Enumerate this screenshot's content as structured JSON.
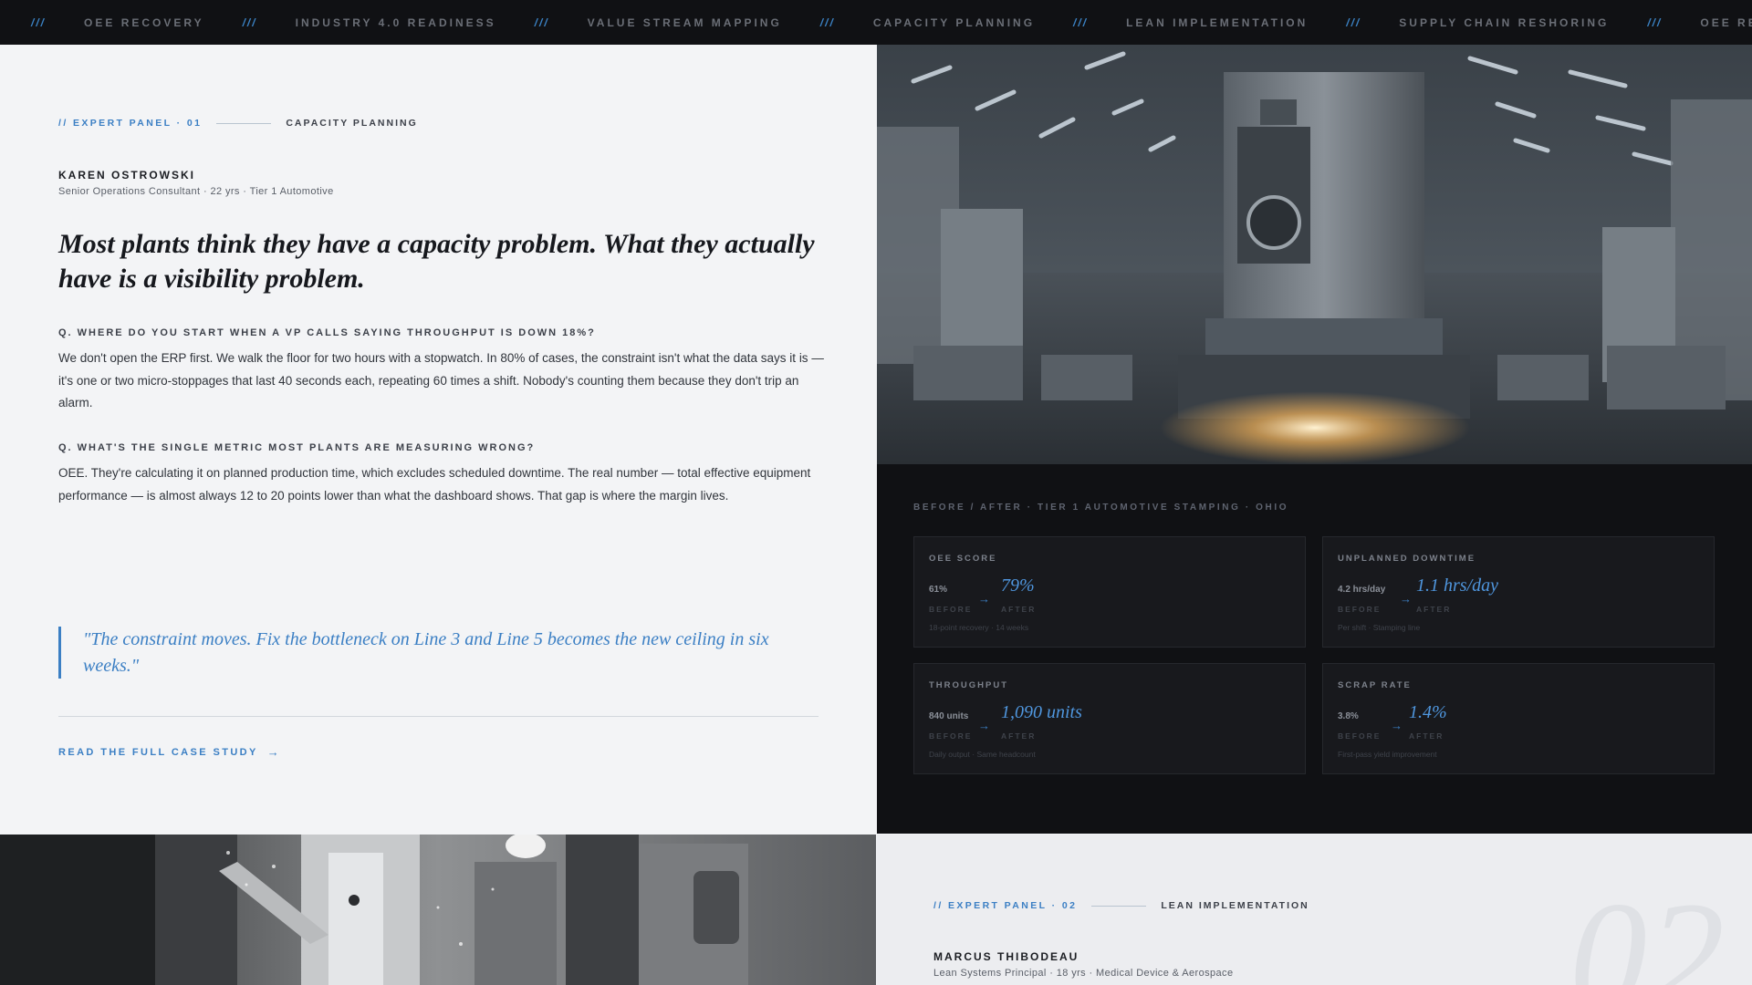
{
  "ticker": {
    "separator": "///",
    "items": [
      "OEE RECOVERY",
      "INDUSTRY 4.0 READINESS",
      "VALUE STREAM MAPPING",
      "CAPACITY PLANNING",
      "LEAN IMPLEMENTATION",
      "SUPPLY CHAIN RESHORING",
      "OEE RECOVERY"
    ]
  },
  "panel1": {
    "code": "// EXPERT PANEL · 01",
    "topic": "CAPACITY PLANNING",
    "name": "KAREN OSTROWSKI",
    "role": "Senior Operations Consultant · 22 yrs · Tier 1 Automotive",
    "headline": "Most plants think they have a capacity problem. What they actually have is a visibility problem.",
    "q1": "Q. WHERE DO YOU START WHEN A VP CALLS SAYING THROUGHPUT IS DOWN 18%?",
    "a1": "We don't open the ERP first. We walk the floor for two hours with a stopwatch. In 80% of cases, the constraint isn't what the data says it is — it's one or two micro-stoppages that last 40 seconds each, repeating 60 times a shift. Nobody's counting them because they don't trip an alarm.",
    "q2": "Q. WHAT'S THE SINGLE METRIC MOST PLANTS ARE MEASURING WRONG?",
    "a2": "OEE. They're calculating it on planned production time, which excludes scheduled downtime. The real number — total effective equipment performance — is almost always 12 to 20 points lower than what the dashboard shows. That gap is where the margin lives.",
    "quote": "\"The constraint moves. Fix the bottleneck on Line 3 and Line 5 becomes the new ceiling in six weeks.\"",
    "cta": "READ THE FULL CASE STUDY",
    "cta_arrow": "→"
  },
  "metrics": {
    "caption": "BEFORE / AFTER · TIER 1 AUTOMOTIVE STAMPING · OHIO",
    "before_label": "BEFORE",
    "after_label": "AFTER",
    "arrow": "→",
    "cards": [
      {
        "title": "OEE SCORE",
        "before": "61%",
        "after": "79%",
        "note": "18-point recovery · 14 weeks"
      },
      {
        "title": "UNPLANNED DOWNTIME",
        "before": "4.2 hrs/day",
        "after": "1.1 hrs/day",
        "note": "Per shift · Stamping line"
      },
      {
        "title": "THROUGHPUT",
        "before": "840 units",
        "after": "1,090 units",
        "note": "Daily output · Same headcount"
      },
      {
        "title": "SCRAP RATE",
        "before": "3.8%",
        "after": "1.4%",
        "note": "First-pass yield improvement"
      }
    ]
  },
  "panel2": {
    "number": "02",
    "code": "// EXPERT PANEL · 02",
    "topic": "LEAN IMPLEMENTATION",
    "name": "MARCUS THIBODEAU",
    "role": "Lean Systems Principal · 18 yrs · Medical Device & Aerospace"
  },
  "colors": {
    "accent": "#3b7fc4",
    "dark_bg": "#101114",
    "light_bg": "#f3f4f6"
  }
}
